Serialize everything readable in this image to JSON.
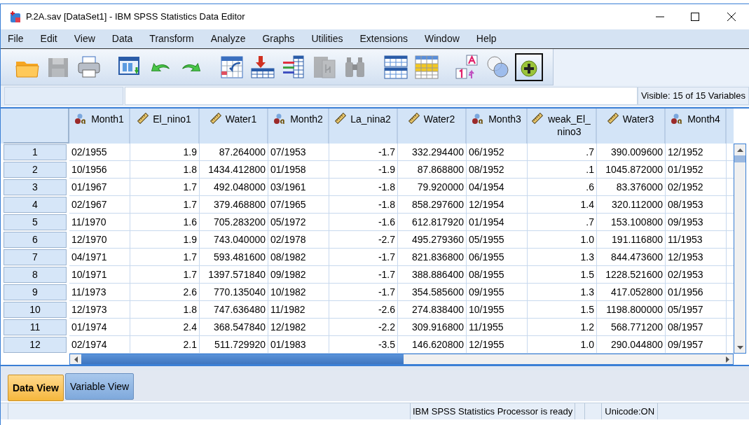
{
  "window": {
    "title": "P.2A.sav [DataSet1] - IBM SPSS Statistics Data Editor"
  },
  "menu": [
    "File",
    "Edit",
    "View",
    "Data",
    "Transform",
    "Analyze",
    "Graphs",
    "Utilities",
    "Extensions",
    "Window",
    "Help"
  ],
  "toolbar": [
    {
      "disabled": false,
      "selected": false
    },
    {
      "disabled": true,
      "selected": false
    },
    {
      "disabled": false,
      "selected": false
    },
    {
      "disabled": false,
      "selected": false
    },
    {
      "disabled": false,
      "selected": false
    },
    {
      "disabled": false,
      "selected": false
    },
    {
      "disabled": false,
      "selected": false
    },
    {
      "disabled": false,
      "selected": false
    },
    {
      "disabled": false,
      "selected": false
    },
    {
      "disabled": true,
      "selected": false
    },
    {
      "disabled": true,
      "selected": false
    },
    {
      "disabled": false,
      "selected": false
    },
    {
      "disabled": false,
      "selected": false
    },
    {
      "disabled": false,
      "selected": false
    },
    {
      "disabled": false,
      "selected": false
    },
    {
      "disabled": false,
      "selected": true
    }
  ],
  "visible_label": "Visible: 15 of 15 Variables",
  "table": {
    "columns": [
      {
        "name": "Month1",
        "kind": "nominal"
      },
      {
        "name": "El_nino1",
        "kind": "scale"
      },
      {
        "name": "Water1",
        "kind": "scale"
      },
      {
        "name": "Month2",
        "kind": "nominal"
      },
      {
        "name": "La_nina2",
        "kind": "scale"
      },
      {
        "name": "Water2",
        "kind": "scale"
      },
      {
        "name": "Month3",
        "kind": "nominal"
      },
      {
        "name": "weak_El_nino3",
        "kind": "scale"
      },
      {
        "name": "Water3",
        "kind": "scale"
      },
      {
        "name": "Month4",
        "kind": "nominal"
      }
    ],
    "rows": [
      {
        "n": "1",
        "cells": [
          "02/1955",
          "1.9",
          "87.264000",
          "07/1953",
          "-1.7",
          "332.294400",
          "06/1952",
          ".7",
          "390.009600",
          "12/1952"
        ]
      },
      {
        "n": "2",
        "cells": [
          "10/1956",
          "1.8",
          "1434.412800",
          "01/1958",
          "-1.9",
          "87.868800",
          "08/1952",
          ".1",
          "1045.872000",
          "01/1952"
        ]
      },
      {
        "n": "3",
        "cells": [
          "01/1967",
          "1.7",
          "492.048000",
          "03/1961",
          "-1.8",
          "79.920000",
          "04/1954",
          ".6",
          "83.376000",
          "02/1952"
        ]
      },
      {
        "n": "4",
        "cells": [
          "02/1967",
          "1.7",
          "379.468800",
          "07/1965",
          "-1.8",
          "858.297600",
          "12/1954",
          "1.4",
          "320.112000",
          "08/1953"
        ]
      },
      {
        "n": "5",
        "cells": [
          "11/1970",
          "1.6",
          "705.283200",
          "05/1972",
          "-1.6",
          "612.817920",
          "01/1954",
          ".7",
          "153.100800",
          "09/1953"
        ]
      },
      {
        "n": "6",
        "cells": [
          "12/1970",
          "1.9",
          "743.040000",
          "02/1978",
          "-2.7",
          "495.279360",
          "05/1955",
          "1.0",
          "191.116800",
          "11/1953"
        ]
      },
      {
        "n": "7",
        "cells": [
          "04/1971",
          "1.7",
          "593.481600",
          "08/1982",
          "-1.7",
          "821.836800",
          "06/1955",
          "1.3",
          "844.473600",
          "12/1953"
        ]
      },
      {
        "n": "8",
        "cells": [
          "10/1971",
          "1.7",
          "1397.571840",
          "09/1982",
          "-1.7",
          "388.886400",
          "08/1955",
          "1.5",
          "1228.521600",
          "02/1953"
        ]
      },
      {
        "n": "9",
        "cells": [
          "11/1973",
          "2.6",
          "770.135040",
          "10/1982",
          "-1.7",
          "354.585600",
          "09/1955",
          "1.3",
          "417.052800",
          "01/1956"
        ]
      },
      {
        "n": "10",
        "cells": [
          "12/1973",
          "1.8",
          "747.636480",
          "11/1982",
          "-2.6",
          "274.838400",
          "10/1955",
          "1.5",
          "1198.800000",
          "05/1957"
        ]
      },
      {
        "n": "11",
        "cells": [
          "01/1974",
          "2.4",
          "368.547840",
          "12/1982",
          "-2.2",
          "309.916800",
          "11/1955",
          "1.2",
          "568.771200",
          "08/1957"
        ]
      },
      {
        "n": "12",
        "cells": [
          "02/1974",
          "2.1",
          "511.729920",
          "01/1983",
          "-3.5",
          "146.620800",
          "12/1955",
          "1.0",
          "290.044800",
          "09/1957"
        ]
      }
    ]
  },
  "tabs": [
    {
      "label": "Data View",
      "selected": true
    },
    {
      "label": "Variable View",
      "selected": false
    }
  ],
  "status_bar": {
    "message": "IBM SPSS Statistics Processor is ready",
    "encoding": "Unicode:ON"
  }
}
